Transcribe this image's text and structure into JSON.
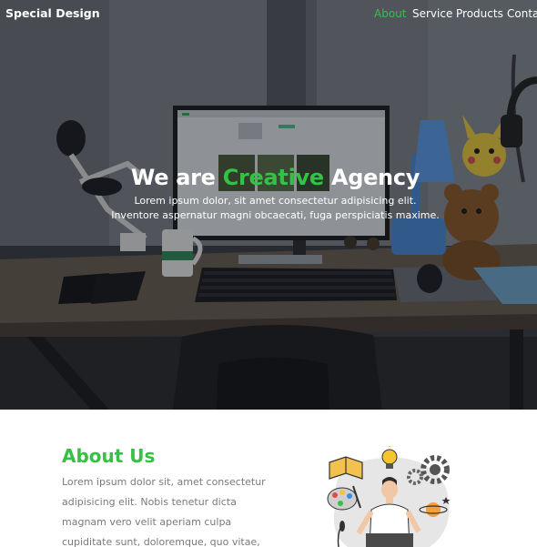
{
  "nav": {
    "logo": "Special Design",
    "links": [
      {
        "label": "About",
        "active": true
      },
      {
        "label": "Service",
        "active": false
      },
      {
        "label": "Products",
        "active": false
      },
      {
        "label": "Contact",
        "active": false
      }
    ]
  },
  "hero": {
    "title_part1": "We are",
    "title_accent": "Creative",
    "title_part2": "Agency",
    "description": "Lorem ipsum dolor, sit amet consectetur adipisicing elit. Inventore aspernatur magni obcaecati, fuga perspiciatis maxime."
  },
  "about": {
    "title": "About Us",
    "text": "Lorem ipsum dolor sit, amet consectetur adipisicing elit. Nobis tenetur dicta magnam vero velit aperiam culpa cupiditate sunt, doloremque, quo vitae, neque illo"
  },
  "colors": {
    "accent": "#34c144",
    "text_muted": "#7a7a7a",
    "background": "#ffffff"
  }
}
